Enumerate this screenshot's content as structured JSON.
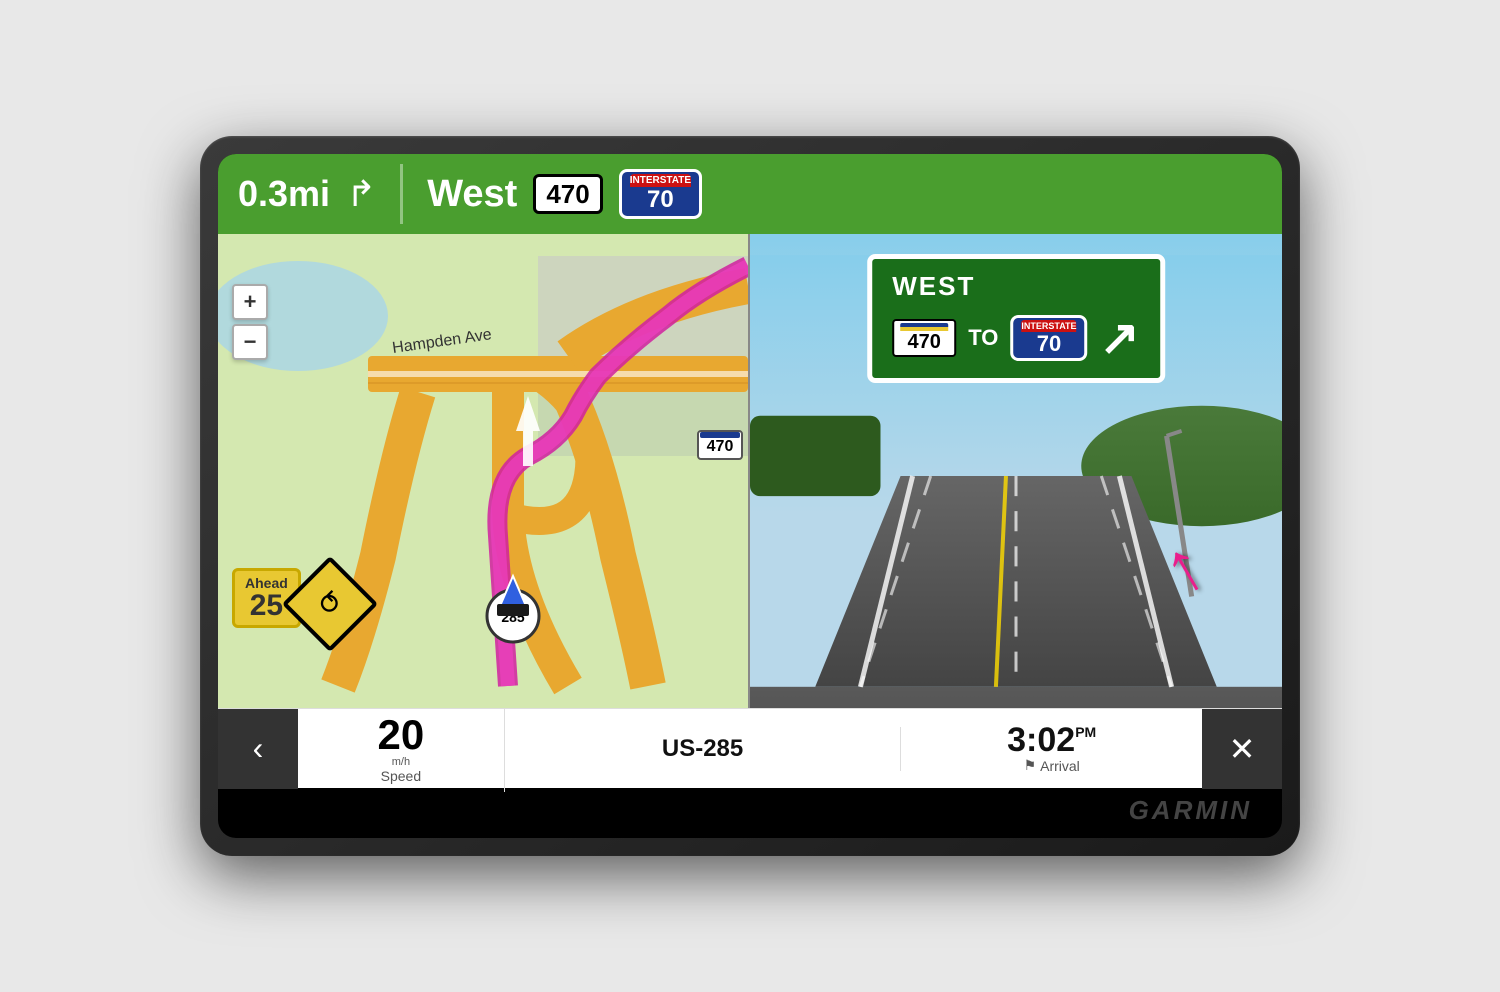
{
  "device": {
    "brand": "GARMIN"
  },
  "nav_bar": {
    "distance": "0.3mi",
    "direction": "West",
    "road1": "470",
    "road2_num": "70",
    "road2_label": "INTERSTATE"
  },
  "map": {
    "street_label": "Hampden Ave",
    "road_badge": "470",
    "us_route": "285",
    "zoom_plus": "+",
    "zoom_minus": "−"
  },
  "ahead_sign": {
    "label": "Ahead",
    "number": "25"
  },
  "highway_sign": {
    "direction": "WEST",
    "road1_num": "470",
    "to_text": "TO",
    "road2_label": "INTERSTATE",
    "road2_num": "70"
  },
  "bottom_bar": {
    "back_icon": "‹",
    "speed_value": "20",
    "speed_unit": "m/h",
    "speed_label": "Speed",
    "road_name": "US-285",
    "arrival_time": "3:02",
    "arrival_ampm": "PM",
    "arrival_label": "Arrival",
    "close_icon": "✕"
  }
}
